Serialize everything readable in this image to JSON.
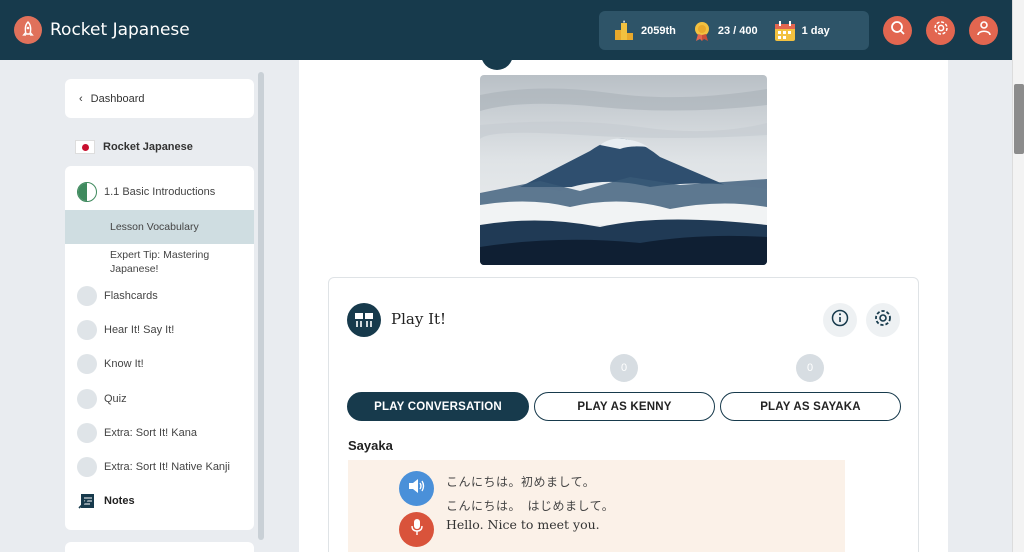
{
  "app": {
    "title": "Rocket Japanese"
  },
  "stats": {
    "rank": "2059th",
    "points": "23 / 400",
    "streak": "1 day"
  },
  "sidebar": {
    "dashboard": "Dashboard",
    "course": "Rocket Japanese",
    "lesson": "1.1 Basic Introductions",
    "subitems": [
      "Lesson Vocabulary",
      "Expert Tip: Mastering Japanese!"
    ],
    "items": [
      "Flashcards",
      "Hear It! Say It!",
      "Know It!",
      "Quiz",
      "Extra: Sort It! Kana",
      "Extra: Sort It! Native Kanji",
      "Notes"
    ]
  },
  "card": {
    "title": "Play It!",
    "scores": [
      "0",
      "0"
    ],
    "buttons": [
      "PLAY CONVERSATION",
      "PLAY AS KENNY",
      "PLAY AS SAYAKA"
    ],
    "speaker": "Sayaka",
    "line_kanji": "こんにちは。初めまして。",
    "line_kana": "こんにちは。　はじめまして。",
    "line_english": "Hello. Nice to meet you."
  }
}
